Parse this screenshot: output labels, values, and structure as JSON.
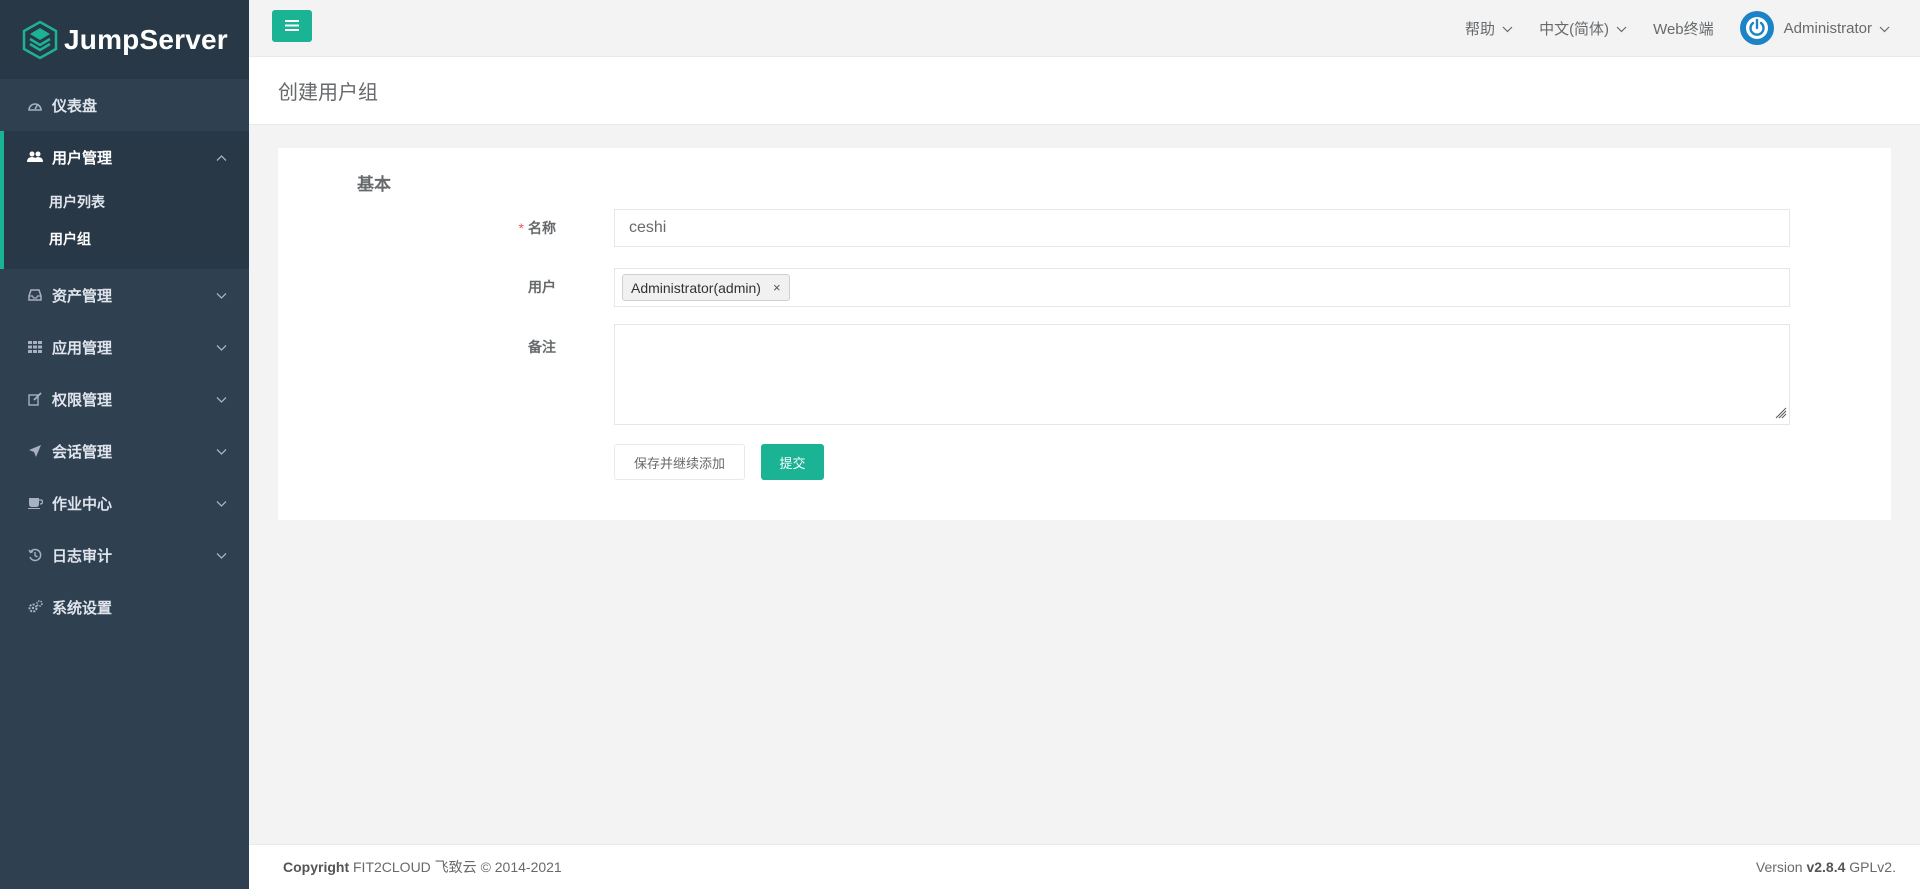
{
  "brand": {
    "name": "JumpServer",
    "accent": "#1ab394",
    "sidebar_bg": "#2f4050"
  },
  "sidebar": {
    "items": [
      {
        "label": "仪表盘",
        "icon": "dashboard-icon"
      },
      {
        "label": "用户管理",
        "icon": "users-icon",
        "expanded": true,
        "children": [
          {
            "label": "用户列表"
          },
          {
            "label": "用户组",
            "current": true
          }
        ]
      },
      {
        "label": "资产管理",
        "icon": "inbox-icon"
      },
      {
        "label": "应用管理",
        "icon": "grid-icon"
      },
      {
        "label": "权限管理",
        "icon": "edit-icon"
      },
      {
        "label": "会话管理",
        "icon": "rocket-icon"
      },
      {
        "label": "作业中心",
        "icon": "coffee-icon"
      },
      {
        "label": "日志审计",
        "icon": "history-icon"
      },
      {
        "label": "系统设置",
        "icon": "gears-icon"
      }
    ]
  },
  "topbar": {
    "help": "帮助",
    "language": "中文(简体)",
    "web_terminal": "Web终端",
    "user": "Administrator"
  },
  "page": {
    "title": "创建用户组"
  },
  "form": {
    "section": "基本",
    "name_label": "名称",
    "name_value": "ceshi",
    "users_label": "用户",
    "selected_users": [
      "Administrator(admin)"
    ],
    "tag_remove": "×",
    "comment_label": "备注",
    "comment_value": "",
    "save_continue": "保存并继续添加",
    "submit": "提交"
  },
  "footer": {
    "copyright_label": "Copyright",
    "copyright_text": "FIT2CLOUD 飞致云 © 2014-2021",
    "version_label": "Version",
    "version": "v2.8.4",
    "license": "GPLv2."
  }
}
